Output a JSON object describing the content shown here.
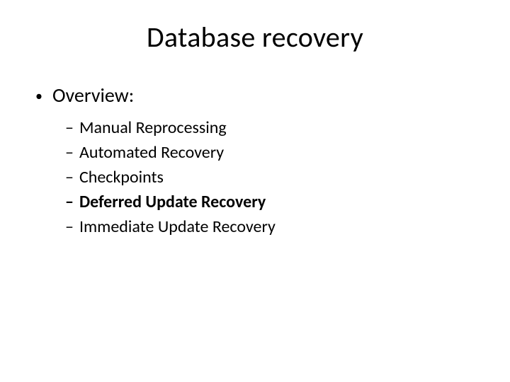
{
  "title": "Database recovery",
  "level1": {
    "bullet": "•",
    "label": "Overview:"
  },
  "dash": "–",
  "items": [
    {
      "text": "Manual Reprocessing",
      "bold": false
    },
    {
      "text": "Automated Recovery",
      "bold": false
    },
    {
      "text": "Checkpoints",
      "bold": false
    },
    {
      "text": "Deferred Update Recovery",
      "bold": true
    },
    {
      "text": "Immediate Update Recovery",
      "bold": false
    }
  ]
}
